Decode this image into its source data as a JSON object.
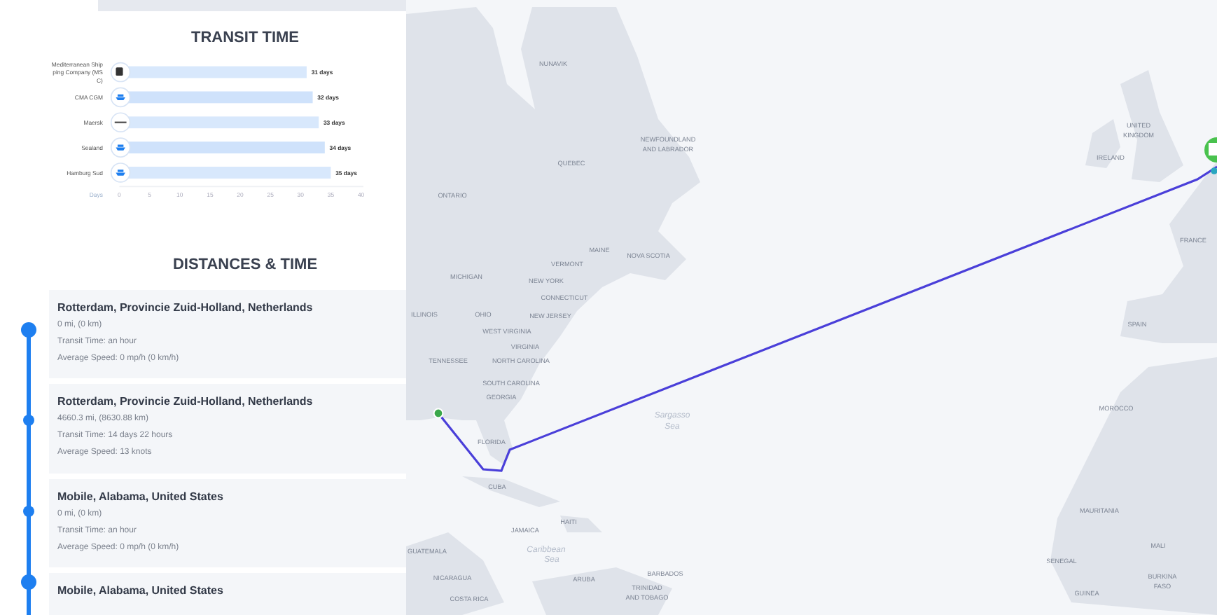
{
  "transit": {
    "title": "TRANSIT TIME",
    "chart_data": {
      "type": "bar",
      "orientation": "horizontal",
      "xlabel": "Days",
      "categories": [
        "Mediterranean Shipping Company (MSC)",
        "CMA CGM",
        "Maersk",
        "Sealand",
        "Hamburg Sud"
      ],
      "values": [
        31,
        32,
        33,
        34,
        35
      ],
      "xlim": [
        0,
        40
      ],
      "xticks": [
        0,
        5,
        10,
        15,
        20,
        25,
        30,
        35,
        40
      ],
      "value_labels": [
        "31 days",
        "32 days",
        "33 days",
        "34 days",
        "35 days"
      ]
    },
    "carriers": [
      {
        "kind": "badge"
      },
      {
        "kind": "ship"
      },
      {
        "kind": "wordmark"
      },
      {
        "kind": "ship"
      },
      {
        "kind": "ship"
      }
    ]
  },
  "distances": {
    "title": "DISTANCES & TIME",
    "stops": [
      {
        "place": "Rotterdam, Provincie Zuid-Holland, Netherlands",
        "distance": "0 mi, (0 km)",
        "transit": "Transit Time: an hour",
        "speed": "Average Speed: 0 mp/h (0 km/h)"
      },
      {
        "place": "Rotterdam, Provincie Zuid-Holland, Netherlands",
        "distance": "4660.3 mi, (8630.88 km)",
        "transit": "Transit Time: 14 days 22 hours",
        "speed": "Average Speed: 13 knots"
      },
      {
        "place": "Mobile, Alabama, United States",
        "distance": "0 mi, (0 km)",
        "transit": "Transit Time: an hour",
        "speed": "Average Speed: 0 mp/h (0 km/h)"
      },
      {
        "place": "Mobile, Alabama, United States"
      }
    ]
  },
  "map": {
    "labels": [
      {
        "text": "NUNAVIK",
        "kind": "land"
      },
      {
        "text": "NEWFOUNDLAND",
        "kind": "land"
      },
      {
        "text": "AND LABRADOR",
        "kind": "land"
      },
      {
        "text": "QUEBEC",
        "kind": "land"
      },
      {
        "text": "ONTARIO",
        "kind": "land"
      },
      {
        "text": "MAINE",
        "kind": "land"
      },
      {
        "text": "NOVA SCOTIA",
        "kind": "land"
      },
      {
        "text": "VERMONT",
        "kind": "land"
      },
      {
        "text": "MICHIGAN",
        "kind": "land"
      },
      {
        "text": "NEW YORK",
        "kind": "land"
      },
      {
        "text": "CONNECTICUT",
        "kind": "land"
      },
      {
        "text": "ILLINOIS",
        "kind": "land"
      },
      {
        "text": "OHIO",
        "kind": "land"
      },
      {
        "text": "NEW JERSEY",
        "kind": "land"
      },
      {
        "text": "WEST VIRGINIA",
        "kind": "land"
      },
      {
        "text": "VIRGINIA",
        "kind": "land"
      },
      {
        "text": "TENNESSEE",
        "kind": "land"
      },
      {
        "text": "NORTH CAROLINA",
        "kind": "land"
      },
      {
        "text": "SOUTH CAROLINA",
        "kind": "land"
      },
      {
        "text": "GEORGIA",
        "kind": "land"
      },
      {
        "text": "FLORIDA",
        "kind": "land"
      },
      {
        "text": "CUBA",
        "kind": "land"
      },
      {
        "text": "JAMAICA",
        "kind": "land"
      },
      {
        "text": "HAITI",
        "kind": "land"
      },
      {
        "text": "GUATEMALA",
        "kind": "land"
      },
      {
        "text": "Caribbean",
        "kind": "sea"
      },
      {
        "text": "Sea",
        "kind": "sea"
      },
      {
        "text": "NICARAGUA",
        "kind": "land"
      },
      {
        "text": "ARUBA",
        "kind": "land"
      },
      {
        "text": "BARBADOS",
        "kind": "land"
      },
      {
        "text": "TRINIDAD",
        "kind": "land"
      },
      {
        "text": "AND TOBAGO",
        "kind": "land"
      },
      {
        "text": "COSTA RICA",
        "kind": "land"
      },
      {
        "text": "Sargasso",
        "kind": "sea"
      },
      {
        "text": "Sea",
        "kind": "sea"
      },
      {
        "text": "UNITED",
        "kind": "land"
      },
      {
        "text": "KINGDOM",
        "kind": "land"
      },
      {
        "text": "IRELAND",
        "kind": "land"
      },
      {
        "text": "FRANCE",
        "kind": "land"
      },
      {
        "text": "SPAIN",
        "kind": "land"
      },
      {
        "text": "MOROCCO",
        "kind": "land"
      },
      {
        "text": "MAURITANIA",
        "kind": "land"
      },
      {
        "text": "SENEGAL",
        "kind": "land"
      },
      {
        "text": "MALI",
        "kind": "land"
      },
      {
        "text": "BURKINA",
        "kind": "land"
      },
      {
        "text": "FASO",
        "kind": "land"
      },
      {
        "text": "GUINEA",
        "kind": "land"
      }
    ]
  }
}
